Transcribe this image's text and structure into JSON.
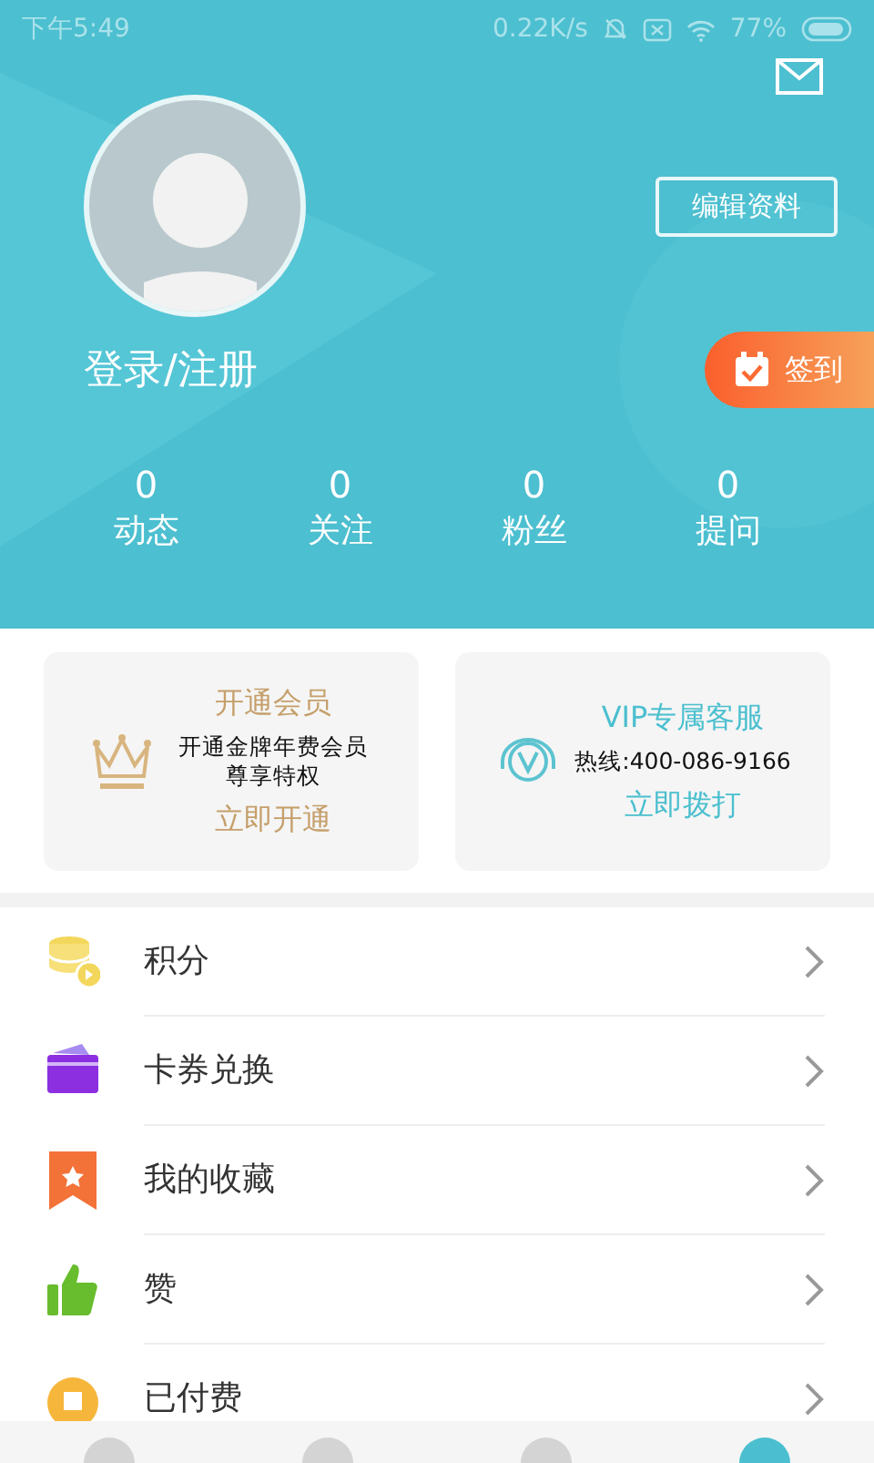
{
  "status_bar": {
    "time": "下午5:49",
    "speed": "0.22K/s",
    "battery": "77%"
  },
  "profile": {
    "login": "登录/注册",
    "edit_button": "编辑资料",
    "checkin_button": "签到"
  },
  "stats": [
    {
      "value": "0",
      "label": "动态"
    },
    {
      "value": "0",
      "label": "关注"
    },
    {
      "value": "0",
      "label": "粉丝"
    },
    {
      "value": "0",
      "label": "提问"
    }
  ],
  "cards": [
    {
      "kind": "member",
      "title": "开通会员",
      "lines": [
        "开通金牌年费会员",
        "尊享特权"
      ],
      "action": "立即开通"
    },
    {
      "kind": "service",
      "title": "VIP专属客服",
      "lines": [
        "热线:400-086-9166"
      ],
      "action": "立即拨打"
    }
  ],
  "menu": [
    {
      "kind": "points",
      "label": "积分"
    },
    {
      "kind": "coupon",
      "label": "卡券兑换"
    },
    {
      "kind": "favorites",
      "label": "我的收藏"
    },
    {
      "kind": "likes",
      "label": "赞"
    },
    {
      "kind": "paid",
      "label": "已付费"
    }
  ],
  "tab_bar": [
    {
      "selected": false
    },
    {
      "selected": false
    },
    {
      "selected": false
    },
    {
      "selected": true
    }
  ]
}
